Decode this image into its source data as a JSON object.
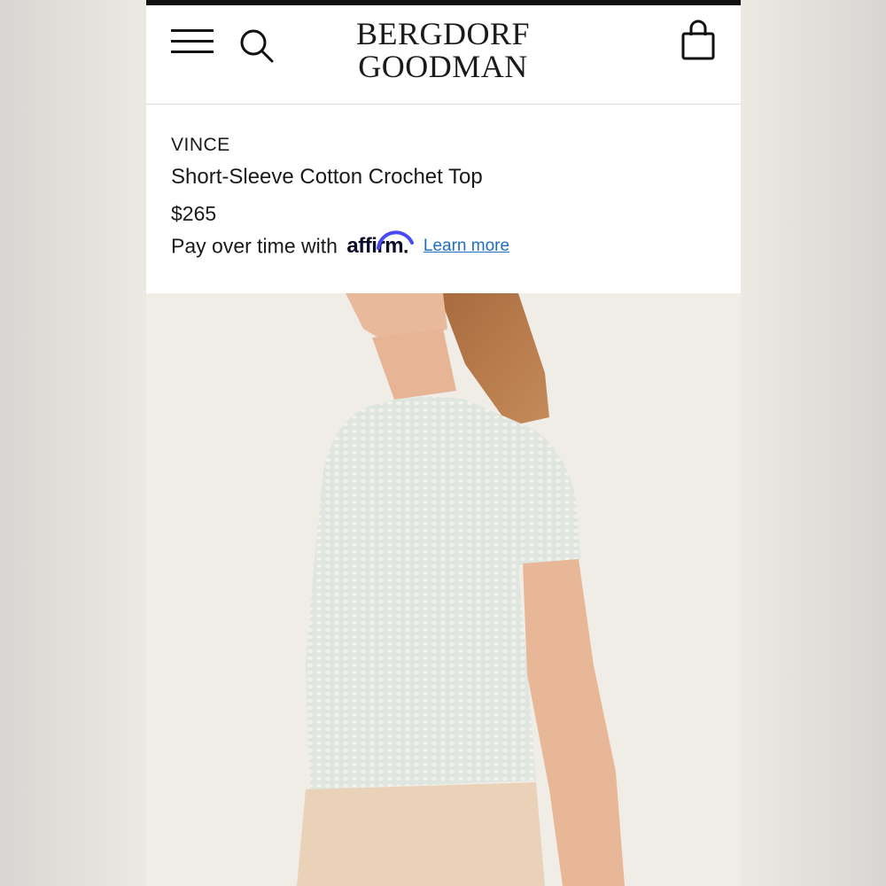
{
  "header": {
    "logo_line1": "BERGDORF",
    "logo_line2": "GOODMAN",
    "menu_icon": "hamburger-menu-icon",
    "search_icon": "search-icon",
    "bag_icon": "shopping-bag-icon"
  },
  "product": {
    "brand": "VINCE",
    "name": "Short-Sleeve Cotton Crochet Top",
    "price": "$265",
    "pay_over_time": "Pay over time with",
    "affirm_logo": "affirm",
    "affirm_period": ".",
    "learn_more": "Learn more"
  },
  "colors": {
    "header_bg": "#ffffff",
    "text": "#1a1a1a",
    "link": "#1e6fc4",
    "affirm_arc": "#4a4af4",
    "image_bg": "#f0ede7",
    "top_bar": "#111111"
  }
}
